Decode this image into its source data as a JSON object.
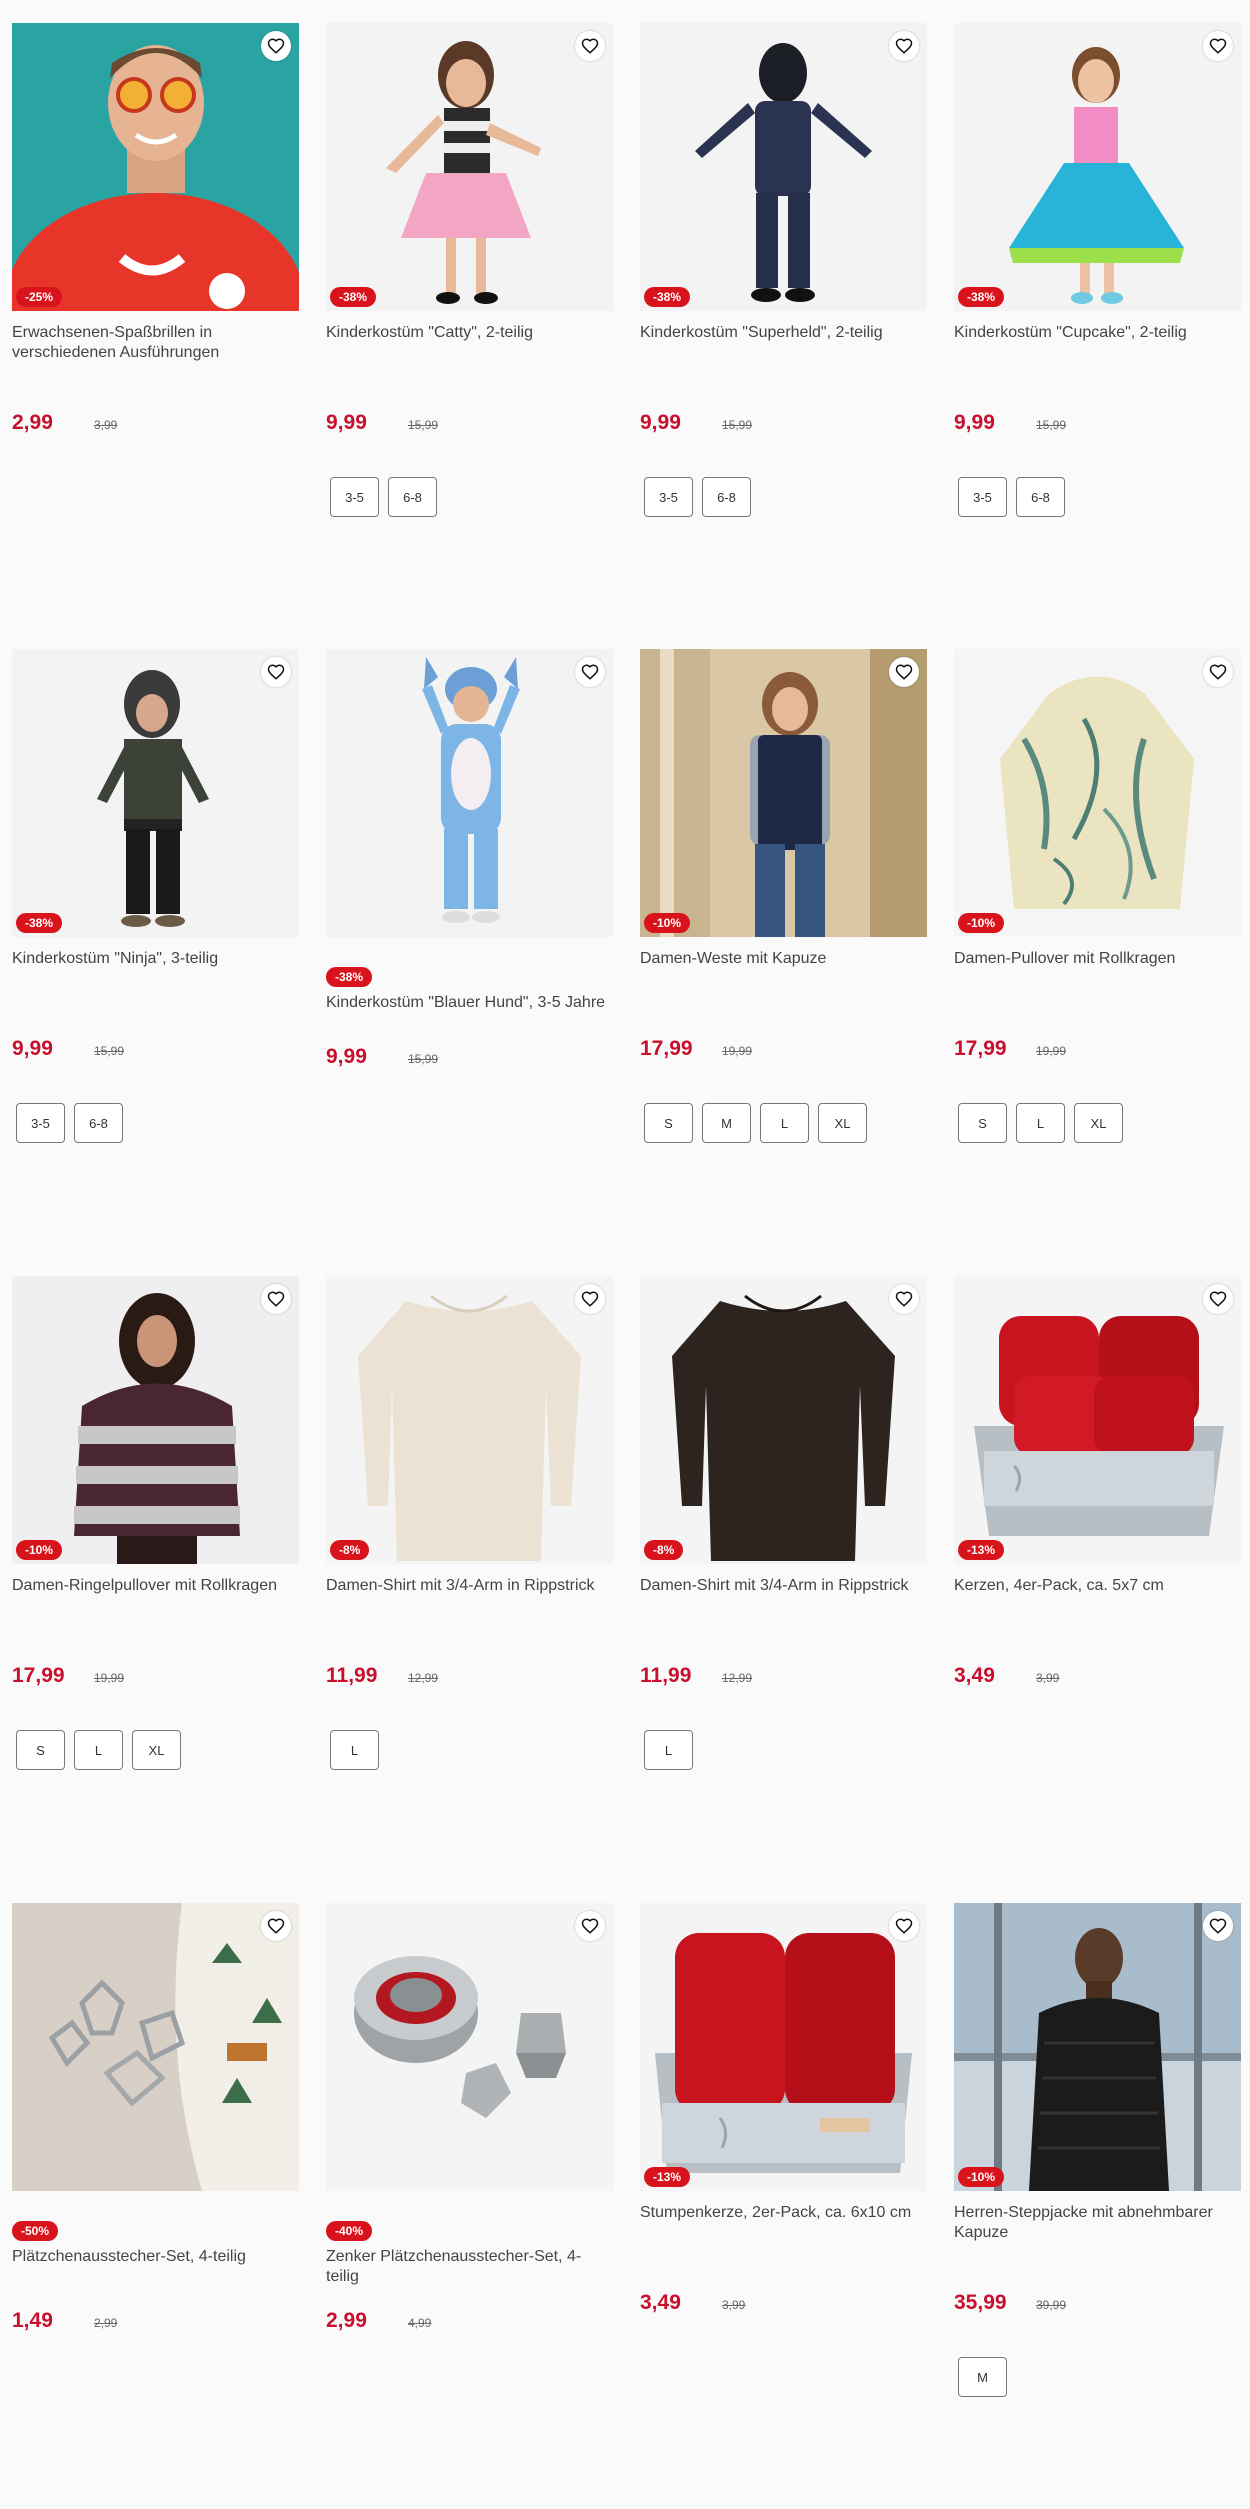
{
  "colors": {
    "sale": "#c8102e",
    "badge": "#d8131b"
  },
  "products": [
    {
      "title": "Erwachsenen-Spaßbrillen in verschiedenen Ausführungen",
      "badge": "-25%",
      "price": "2,99",
      "old_price": "3,99",
      "sizes": []
    },
    {
      "title": "Kinderkostüm \"Catty\", 2-teilig",
      "badge": "-38%",
      "price": "9,99",
      "old_price": "15,99",
      "sizes": [
        "3-5",
        "6-8"
      ]
    },
    {
      "title": "Kinderkostüm \"Superheld\", 2-teilig",
      "badge": "-38%",
      "price": "9,99",
      "old_price": "15,99",
      "sizes": [
        "3-5",
        "6-8"
      ]
    },
    {
      "title": "Kinderkostüm \"Cupcake\", 2-teilig",
      "badge": "-38%",
      "price": "9,99",
      "old_price": "15,99",
      "sizes": [
        "3-5",
        "6-8"
      ]
    },
    {
      "title": "Kinderkostüm \"Ninja\", 3-teilig",
      "badge": "-38%",
      "price": "9,99",
      "old_price": "15,99",
      "sizes": [
        "3-5",
        "6-8"
      ]
    },
    {
      "title": "Kinderkostüm \"Blauer Hund\", 3-5 Jahre",
      "badge": "-38%",
      "price": "9,99",
      "old_price": "15,99",
      "sizes": []
    },
    {
      "title": "Damen-Weste mit Kapuze",
      "badge": "-10%",
      "price": "17,99",
      "old_price": "19,99",
      "sizes": [
        "S",
        "M",
        "L",
        "XL"
      ]
    },
    {
      "title": "Damen-Pullover mit Rollkragen",
      "badge": "-10%",
      "price": "17,99",
      "old_price": "19,99",
      "sizes": [
        "S",
        "L",
        "XL"
      ]
    },
    {
      "title": "Damen-Ringelpullover mit Rollkragen",
      "badge": "-10%",
      "price": "17,99",
      "old_price": "19,99",
      "sizes": [
        "S",
        "L",
        "XL"
      ]
    },
    {
      "title": "Damen-Shirt mit 3/4-Arm in Rippstrick",
      "badge": "-8%",
      "price": "11,99",
      "old_price": "12,99",
      "sizes": [
        "L"
      ]
    },
    {
      "title": "Damen-Shirt mit 3/4-Arm in Rippstrick",
      "badge": "-8%",
      "price": "11,99",
      "old_price": "12,99",
      "sizes": [
        "L"
      ]
    },
    {
      "title": "Kerzen, 4er-Pack, ca. 5x7 cm",
      "badge": "-13%",
      "price": "3,49",
      "old_price": "3,99",
      "sizes": []
    },
    {
      "title": "Plätzchenausstecher-Set, 4-teilig",
      "badge": "-50%",
      "price": "1,49",
      "old_price": "2,99",
      "sizes": []
    },
    {
      "title": "Zenker Plätzchenausstecher-Set, 4-teilig",
      "badge": "-40%",
      "price": "2,99",
      "old_price": "4,99",
      "sizes": []
    },
    {
      "title": "Stumpenkerze, 2er-Pack, ca. 6x10 cm",
      "badge": "-13%",
      "price": "3,49",
      "old_price": "3,99",
      "sizes": []
    },
    {
      "title": "Herren-Steppjacke mit abnehmbarer Kapuze",
      "badge": "-10%",
      "price": "35,99",
      "old_price": "39,99",
      "sizes": [
        "M"
      ]
    }
  ]
}
